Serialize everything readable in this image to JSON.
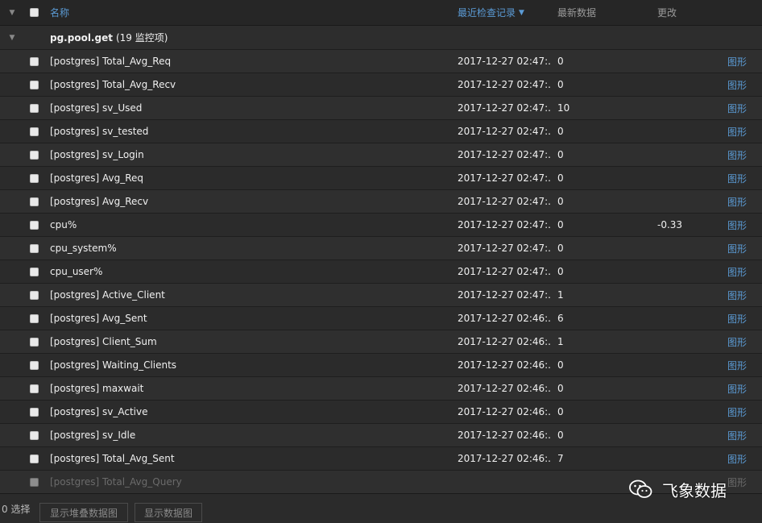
{
  "header": {
    "name_label": "名称",
    "time_label": "最近检查记录",
    "value_label": "最新数据",
    "change_label": "更改"
  },
  "group": {
    "name": "pg.pool.get",
    "count": "(19 监控项)"
  },
  "items": [
    {
      "name": "[postgres] Total_Avg_Req",
      "time": "2017-12-27 02:47:...",
      "value": "0",
      "change": "",
      "graph": "图形"
    },
    {
      "name": "[postgres] Total_Avg_Recv",
      "time": "2017-12-27 02:47:...",
      "value": "0",
      "change": "",
      "graph": "图形"
    },
    {
      "name": "[postgres] sv_Used",
      "time": "2017-12-27 02:47:...",
      "value": "10",
      "change": "",
      "graph": "图形"
    },
    {
      "name": "[postgres] sv_tested",
      "time": "2017-12-27 02:47:...",
      "value": "0",
      "change": "",
      "graph": "图形"
    },
    {
      "name": "[postgres] sv_Login",
      "time": "2017-12-27 02:47:...",
      "value": "0",
      "change": "",
      "graph": "图形"
    },
    {
      "name": "[postgres] Avg_Req",
      "time": "2017-12-27 02:47:...",
      "value": "0",
      "change": "",
      "graph": "图形"
    },
    {
      "name": "[postgres] Avg_Recv",
      "time": "2017-12-27 02:47:...",
      "value": "0",
      "change": "",
      "graph": "图形"
    },
    {
      "name": "cpu%",
      "time": "2017-12-27 02:47:...",
      "value": "0",
      "change": "-0.33",
      "graph": "图形"
    },
    {
      "name": "cpu_system%",
      "time": "2017-12-27 02:47:...",
      "value": "0",
      "change": "",
      "graph": "图形"
    },
    {
      "name": "cpu_user%",
      "time": "2017-12-27 02:47:...",
      "value": "0",
      "change": "",
      "graph": "图形"
    },
    {
      "name": "[postgres] Active_Client",
      "time": "2017-12-27 02:47:...",
      "value": "1",
      "change": "",
      "graph": "图形"
    },
    {
      "name": "[postgres] Avg_Sent",
      "time": "2017-12-27 02:46:...",
      "value": "6",
      "change": "",
      "graph": "图形"
    },
    {
      "name": "[postgres] Client_Sum",
      "time": "2017-12-27 02:46:...",
      "value": "1",
      "change": "",
      "graph": "图形"
    },
    {
      "name": "[postgres] Waiting_Clients",
      "time": "2017-12-27 02:46:...",
      "value": "0",
      "change": "",
      "graph": "图形"
    },
    {
      "name": "[postgres] maxwait",
      "time": "2017-12-27 02:46:...",
      "value": "0",
      "change": "",
      "graph": "图形"
    },
    {
      "name": "[postgres] sv_Active",
      "time": "2017-12-27 02:46:...",
      "value": "0",
      "change": "",
      "graph": "图形"
    },
    {
      "name": "[postgres] sv_Idle",
      "time": "2017-12-27 02:46:...",
      "value": "0",
      "change": "",
      "graph": "图形"
    },
    {
      "name": "[postgres] Total_Avg_Sent",
      "time": "2017-12-27 02:46:...",
      "value": "7",
      "change": "",
      "graph": "图形"
    },
    {
      "name": "[postgres] Total_Avg_Query",
      "time": "",
      "value": "",
      "change": "",
      "graph": "图形"
    }
  ],
  "footer": {
    "selected": "0 选择",
    "stacked_button": "显示堆叠数据图",
    "graph_button": "显示数据图"
  },
  "watermark": {
    "text": "飞象数据"
  },
  "colors": {
    "link": "#5b9bd5",
    "background": "#2b2b2b"
  }
}
